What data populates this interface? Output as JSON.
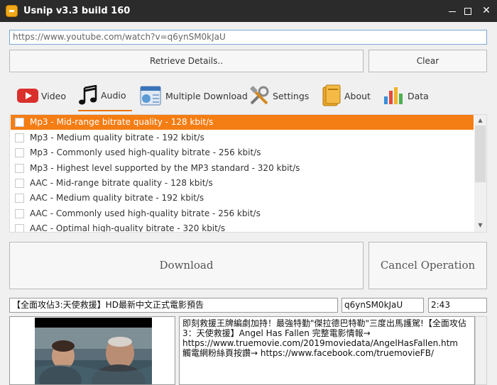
{
  "window": {
    "title": "Usnip v3.3 build 160"
  },
  "url_input": {
    "value": "https://www.youtube.com/watch?v=q6ynSM0kJaU"
  },
  "buttons": {
    "retrieve": "Retrieve Details..",
    "clear": "Clear",
    "download": "Download",
    "cancel": "Cancel Operation"
  },
  "tabs": [
    {
      "label": "Video",
      "icon": "youtube-play-icon"
    },
    {
      "label": "Audio",
      "icon": "music-note-icon",
      "active": true
    },
    {
      "label": "Multiple Download",
      "icon": "multiple-download-icon"
    },
    {
      "label": "Settings",
      "icon": "tools-icon"
    },
    {
      "label": "About",
      "icon": "books-icon"
    },
    {
      "label": "Data",
      "icon": "bar-chart-icon"
    }
  ],
  "formats": [
    {
      "label": "Mp3 -  Mid-range bitrate quality - 128 kbit/s",
      "selected": true
    },
    {
      "label": "Mp3 -  Medium quality bitrate - 192 kbit/s"
    },
    {
      "label": "Mp3 -  Commonly used high-quality bitrate - 256 kbit/s"
    },
    {
      "label": "Mp3 -  Highest level supported by the MP3 standard - 320 kbit/s"
    },
    {
      "label": "AAC -  Mid-range bitrate quality - 128 kbit/s"
    },
    {
      "label": "AAC -  Medium quality bitrate - 192 kbit/s"
    },
    {
      "label": "AAC -  Commonly used high-quality bitrate - 256 kbit/s"
    },
    {
      "label": "AAC -  Optimal high-quality bitrate  - 320 kbit/s"
    }
  ],
  "video_info": {
    "title": "【全面攻佔3:天使救援】HD最新中文正式電影預告",
    "id": "q6ynSM0kJaU",
    "duration": "2:43",
    "description": "即刻救援王牌編劇加持！最強特勤\"傑拉德巴特勒\"三度出馬護駕!【全面攻佔3：天使救援】Angel Has Fallen 完整電影情報→\nhttps://www.truemovie.com/2019moviedata/AngelHasFallen.htm\n觸電網粉絲頁按讚→ https://www.facebook.com/truemovieFB/"
  },
  "colors": {
    "accent": "#f47d14",
    "titlebar": "#2b2b2b"
  }
}
